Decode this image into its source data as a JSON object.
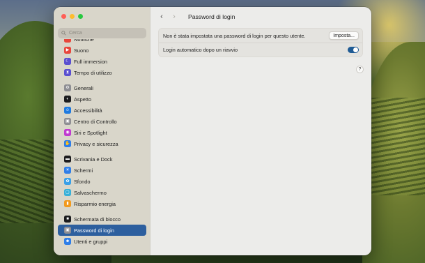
{
  "window": {
    "title": "Password di login"
  },
  "search": {
    "placeholder": "Cerca"
  },
  "sidebar": {
    "groups": [
      [
        {
          "label": "Notifiche",
          "icon": "bell-icon",
          "color": "#e8463c"
        },
        {
          "label": "Suono",
          "icon": "speaker-icon",
          "color": "#e8463c"
        },
        {
          "label": "Full immersion",
          "icon": "moon-icon",
          "color": "#5a4fd0"
        },
        {
          "label": "Tempo di utilizzo",
          "icon": "hourglass-icon",
          "color": "#5a4fd0"
        }
      ],
      [
        {
          "label": "Generali",
          "icon": "gear-icon",
          "color": "#8e8e93"
        },
        {
          "label": "Aspetto",
          "icon": "appearance-icon",
          "color": "#1c1c1e"
        },
        {
          "label": "Accessibilità",
          "icon": "accessibility-icon",
          "color": "#1f7ae0"
        },
        {
          "label": "Centro di Controllo",
          "icon": "control-center-icon",
          "color": "#8e8e93"
        },
        {
          "label": "Siri e Spotlight",
          "icon": "siri-icon",
          "color": "#c03ad0"
        },
        {
          "label": "Privacy e sicurezza",
          "icon": "hand-icon",
          "color": "#2f7ee8"
        }
      ],
      [
        {
          "label": "Scrivania e Dock",
          "icon": "dock-icon",
          "color": "#1c1c1e"
        },
        {
          "label": "Schermi",
          "icon": "display-icon",
          "color": "#2f7ee8"
        },
        {
          "label": "Sfondo",
          "icon": "wallpaper-icon",
          "color": "#3aa0e8"
        },
        {
          "label": "Salvaschermo",
          "icon": "screensaver-icon",
          "color": "#38b0d8"
        },
        {
          "label": "Risparmio energia",
          "icon": "battery-icon",
          "color": "#f29a1e"
        }
      ],
      [
        {
          "label": "Schermata di blocco",
          "icon": "lock-screen-icon",
          "color": "#1c1c1e"
        },
        {
          "label": "Password di login",
          "icon": "lock-icon",
          "color": "#8e8e93",
          "selected": true
        },
        {
          "label": "Utenti e gruppi",
          "icon": "users-icon",
          "color": "#2f7ee8"
        }
      ]
    ]
  },
  "main": {
    "rows": [
      {
        "label": "Non è stata impostata una password di login per questo utente.",
        "button": "Imposta..."
      },
      {
        "label": "Login automatico dopo un riavvio",
        "toggle": true
      }
    ],
    "help_label": "?"
  },
  "colors": {
    "accent": "#2d5f9e",
    "toggle_on": "#1f5b94"
  }
}
